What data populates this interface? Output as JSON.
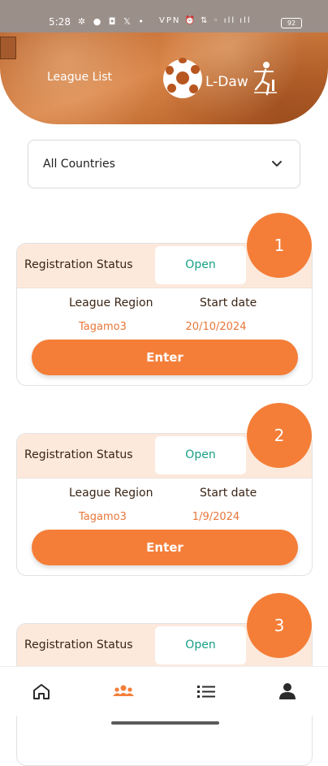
{
  "status_bar": {
    "time": "5:28",
    "left_icons": "✲ ● ◘ 𝕏 •",
    "right_icons": "VPN ⏰ ⇅ ◦ ıll ıll",
    "battery": "92"
  },
  "header": {
    "title": "League List",
    "logo_text": "L-Daw"
  },
  "filter": {
    "selected": "All Countries"
  },
  "card_labels": {
    "registration_status": "Registration Status",
    "league_region": "League Region",
    "start_date": "Start date",
    "enter": "Enter"
  },
  "leagues": [
    {
      "number": "1",
      "status": "Open",
      "region": "Tagamo3",
      "start_date": "20/10/2024"
    },
    {
      "number": "2",
      "status": "Open",
      "region": "Tagamo3",
      "start_date": "1/9/2024"
    },
    {
      "number": "3",
      "status": "Open",
      "region": "",
      "start_date": ""
    }
  ],
  "nav": {
    "items": [
      "home-icon",
      "teams-icon",
      "list-icon",
      "profile-icon"
    ],
    "active_index": 1
  },
  "colors": {
    "accent": "#f47e38",
    "status_open": "#16a085",
    "card_header_bg": "#fce9dc",
    "nav_inactive": "#2b2b2b"
  }
}
